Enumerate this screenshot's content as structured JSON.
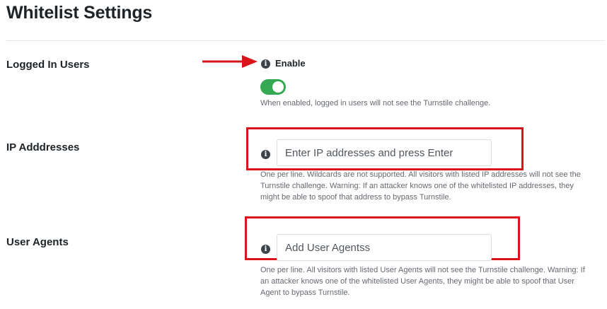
{
  "page": {
    "title": "Whitelist Settings"
  },
  "logged_in_users": {
    "label": "Logged In Users",
    "toggle_label": "Enable",
    "toggle_state": "on",
    "help": "When enabled, logged in users will not see the Turnstile challenge."
  },
  "ip_addresses": {
    "label": "IP Adddresses",
    "placeholder": "Enter IP addresses and press Enter",
    "value": "",
    "help": [
      "One per line. Wildcards are not supported. All visitors with listed IP addresses will not see the",
      "Turnstile challenge. Warning: If an attacker knows one of the whitelisted IP addresses, they",
      "might be able to spoof that address to bypass Turnstile."
    ]
  },
  "user_agents": {
    "label": "User Agents",
    "placeholder": "Add User Agentss",
    "value": "",
    "help": [
      "One per line. All visitors with listed User Agents will not see the Turnstile challenge. Warning: If",
      "an attacker knows one of the whitelisted User Agents, they might be able to spoof that User",
      "Agent to bypass Turnstile."
    ]
  },
  "icons": {
    "info": "i"
  },
  "colors": {
    "toggle_on": "#34a853",
    "annotation_red": "#d9141a",
    "text": "#1d2327",
    "muted": "#646970"
  }
}
